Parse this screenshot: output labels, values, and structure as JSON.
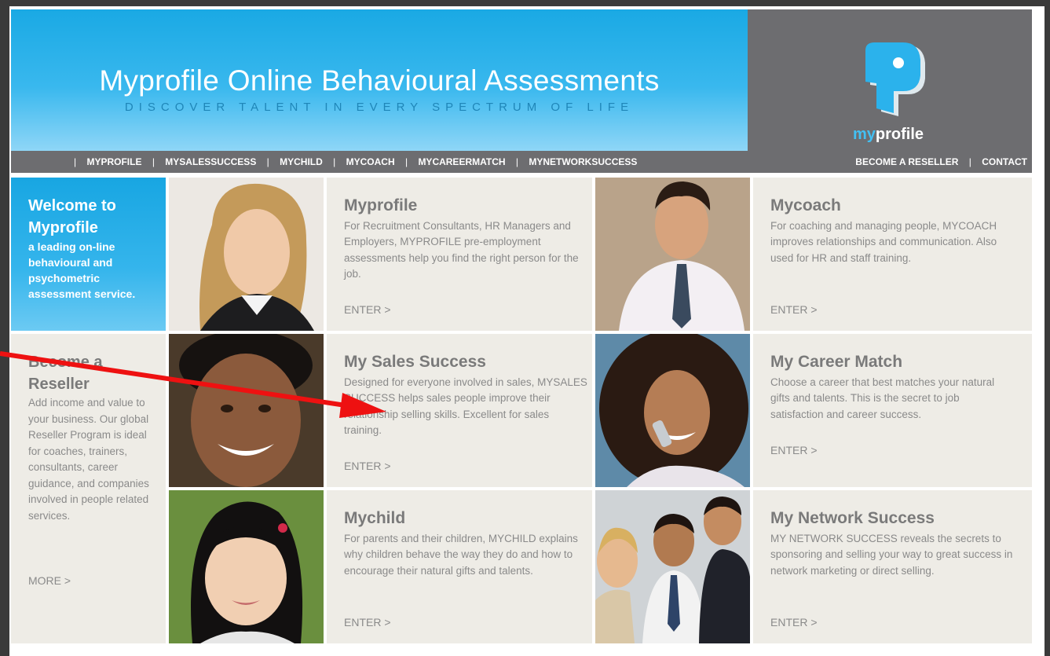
{
  "banner": {
    "title": "Myprofile Online Behavioural Assessments",
    "tagline": "DISCOVER TALENT IN EVERY SPECTRUM OF LIFE"
  },
  "logo": {
    "text_my": "my",
    "text_profile": "profile"
  },
  "nav": {
    "left": [
      "MYPROFILE",
      "MYSALESSUCCESS",
      "MYCHILD",
      "MYCOACH",
      "MYCAREERMATCH",
      "MYNETWORKSUCCESS"
    ],
    "right": [
      "BECOME A RESELLER",
      "CONTACT"
    ],
    "separator": "|"
  },
  "welcome": {
    "heading": "Welcome to Myprofile",
    "text": "a leading on-line behavioural and psychometric assessment service."
  },
  "reseller": {
    "heading": "Become a Reseller",
    "text": "Add income and value to your business. Our global Reseller Program is ideal for coaches, trainers, consultants, career guidance, and companies involved in people related services.",
    "more": "MORE >"
  },
  "products": [
    {
      "title": "Myprofile",
      "text": "For Recruitment Consultants, HR Managers and Employers, MYPROFILE pre-employment assessments help you find the right person for the job.",
      "enter": "ENTER >"
    },
    {
      "title": "Mycoach",
      "text": "For coaching and managing people, MYCOACH improves relationships and communication. Also used for HR and staff training.",
      "enter": "ENTER >"
    },
    {
      "title": "My Sales Success",
      "text": "Designed for everyone involved in sales, MYSALES SUCCESS helps sales people improve their relationship selling skills. Excellent for sales training.",
      "enter": "ENTER >"
    },
    {
      "title": "My Career Match",
      "text": "Choose a career that best matches your natural gifts and talents. This is the secret to job satisfaction and career success.",
      "enter": "ENTER >"
    },
    {
      "title": "Mychild",
      "text": "For parents and their children, MYCHILD explains why children behave the way they do and how to encourage their natural gifts and talents.",
      "enter": "ENTER >"
    },
    {
      "title": "My Network Success",
      "text": "MY NETWORK SUCCESS reveals the secrets to sponsoring and selling your way to great success in network marketing or direct selling.",
      "enter": "ENTER >"
    }
  ],
  "colors": {
    "accent": "#1aa9e4",
    "panel_gray": "#6d6d70",
    "cell_bg": "#eeece6",
    "arrow_red": "#ee1111"
  }
}
